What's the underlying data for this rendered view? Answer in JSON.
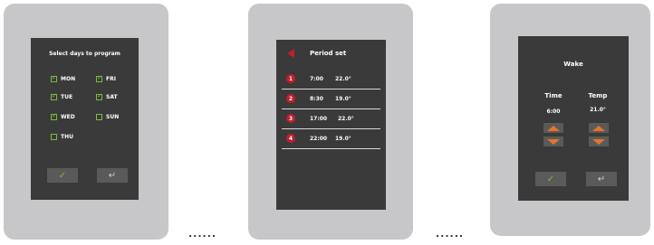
{
  "colors": {
    "accent_green": "#7bbd3d",
    "accent_red": "#c51d2a",
    "accent_orange": "#e8732a",
    "screen_bg": "#3a3a3a",
    "device_bezel": "#c7c7c9"
  },
  "connector": {
    "dots": "......"
  },
  "screen1": {
    "title": "Select days to program",
    "days": [
      {
        "label": "MON",
        "checked": true
      },
      {
        "label": "TUE",
        "checked": true
      },
      {
        "label": "WED",
        "checked": true
      },
      {
        "label": "THU",
        "checked": false
      },
      {
        "label": "FRI",
        "checked": true
      },
      {
        "label": "SAT",
        "checked": true
      },
      {
        "label": "SUN",
        "checked": false
      }
    ],
    "ok_icon": "✓",
    "back_icon": "↵"
  },
  "screen2": {
    "title": "Period set",
    "periods": [
      {
        "num": "1",
        "time": "7:00",
        "temp": "22.0°"
      },
      {
        "num": "2",
        "time": "8:30",
        "temp": "19.0°"
      },
      {
        "num": "3",
        "time": "17:00",
        "temp": "22.0°"
      },
      {
        "num": "4",
        "time": "22:00",
        "temp": "19.0°"
      }
    ]
  },
  "screen3": {
    "title": "Wake",
    "time_label": "Time",
    "time_value": "6:00",
    "temp_label": "Temp",
    "temp_value": "21.0°",
    "ok_icon": "✓",
    "back_icon": "↵"
  }
}
